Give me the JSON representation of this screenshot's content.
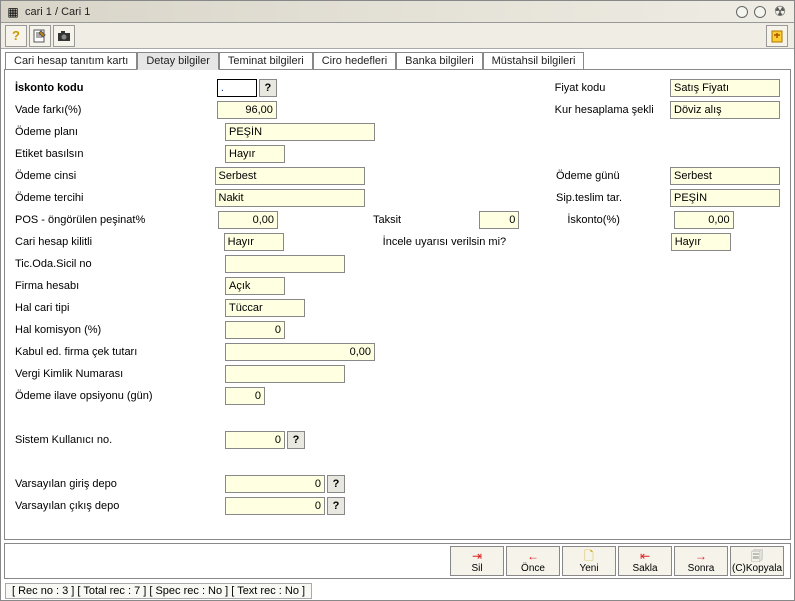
{
  "window": {
    "title": "cari 1 / Cari 1"
  },
  "tabs": [
    {
      "label": "Cari hesap tanıtım kartı"
    },
    {
      "label": "Detay bilgiler"
    },
    {
      "label": "Teminat bilgileri"
    },
    {
      "label": "Ciro hedefleri"
    },
    {
      "label": "Banka bilgileri"
    },
    {
      "label": "Müstahsil bilgileri"
    }
  ],
  "labels": {
    "iskonto_kodu": "İskonto kodu",
    "fiyat_kodu": "Fiyat kodu",
    "vade_farki": "Vade farkı(%)",
    "kur_hesaplama": "Kur hesaplama şekli",
    "odeme_plani": "Ödeme planı",
    "etiket_basilsin": "Etiket basılsın",
    "odeme_cinsi": "Ödeme cinsi",
    "odeme_gunu": "Ödeme günü",
    "odeme_tercihi": "Ödeme tercihi",
    "sip_teslim": "Sip.teslim tar.",
    "pos_pesinat": "POS - öngörülen peşinat%",
    "taksit": "Taksit",
    "iskonto_pct": "İskonto(%)",
    "cari_kilitli": "Cari hesap kilitli",
    "incele_uyarisi": "İncele uyarısı verilsin mi?",
    "tic_oda": "Tic.Oda.Sicil no",
    "firma_hesabi": "Firma hesabı",
    "hal_cari_tipi": "Hal cari tipi",
    "hal_komisyon": "Hal komisyon (%)",
    "kabul_cek": "Kabul ed. firma çek tutarı",
    "vergi_kimlik": "Vergi Kimlik Numarası",
    "odeme_ilave": "Ödeme ilave opsiyonu (gün)",
    "sistem_kullanici": "Sistem Kullanıcı no.",
    "varsayilan_giris": "Varsayılan giriş depo",
    "varsayilan_cikis": "Varsayılan çıkış depo"
  },
  "values": {
    "iskonto_kodu": ".",
    "fiyat_kodu": "Satış Fiyatı",
    "vade_farki": "96,00",
    "kur_hesaplama": "Döviz alış",
    "odeme_plani": "PEŞİN",
    "etiket_basilsin": "Hayır",
    "odeme_cinsi": "Serbest",
    "odeme_gunu": "Serbest",
    "odeme_tercihi": "Nakit",
    "sip_teslim": "PEŞİN",
    "pos_pesinat": "0,00",
    "taksit": "0",
    "iskonto_pct": "0,00",
    "cari_kilitli": "Hayır",
    "incele_uyarisi": "Hayır",
    "tic_oda": "",
    "firma_hesabi": "Açık",
    "hal_cari_tipi": "Tüccar",
    "hal_komisyon": "0",
    "kabul_cek": "0,00",
    "vergi_kimlik": "",
    "odeme_ilave": "0",
    "sistem_kullanici": "0",
    "varsayilan_giris": "0",
    "varsayilan_cikis": "0"
  },
  "footer": {
    "sil": "Sil",
    "once": "Önce",
    "yeni": "Yeni",
    "sakla": "Sakla",
    "sonra": "Sonra",
    "kopyala": "(C)Kopyala"
  },
  "status": "[ Rec no : 3 ] [ Total rec : 7 ] [ Spec rec : No ] [ Text rec : No ]",
  "q": "?"
}
